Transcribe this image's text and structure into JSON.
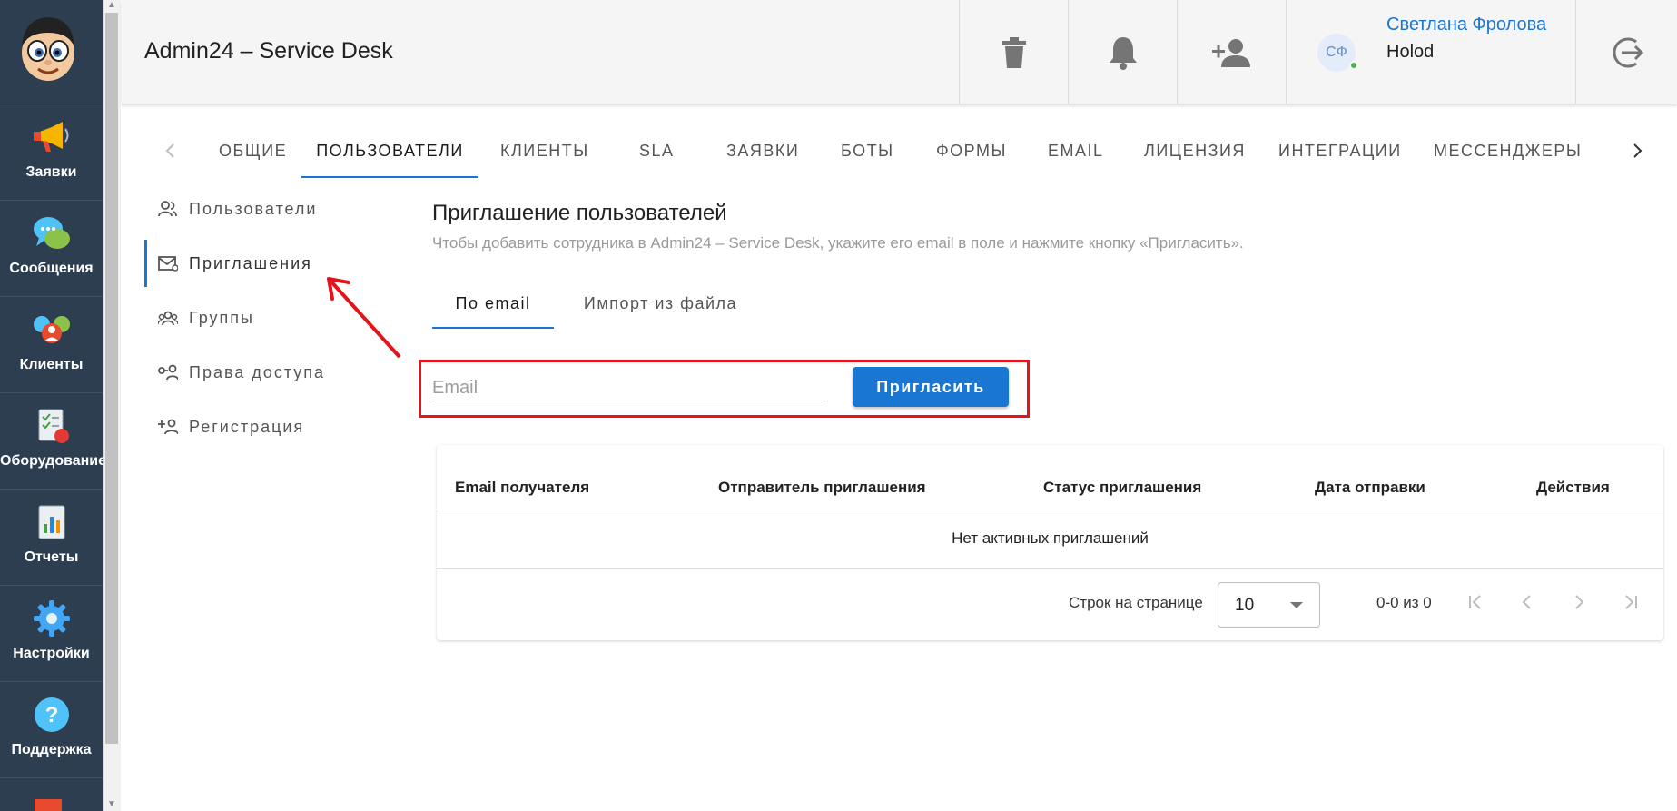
{
  "app": {
    "title": "Admin24 – Service Desk"
  },
  "sidebar": {
    "items": [
      {
        "label": "Заявки",
        "icon": "megaphone-icon"
      },
      {
        "label": "Сообщения",
        "icon": "chat-bubbles-icon"
      },
      {
        "label": "Клиенты",
        "icon": "clients-icon"
      },
      {
        "label": "Оборудование",
        "icon": "equipment-icon"
      },
      {
        "label": "Отчеты",
        "icon": "report-icon"
      },
      {
        "label": "Настройки",
        "icon": "gear-icon"
      },
      {
        "label": "Поддержка",
        "icon": "help-icon"
      }
    ]
  },
  "header": {
    "user": {
      "initials": "СФ",
      "name": "Светлана Фролова",
      "org": "Holod",
      "status_color": "#4caf50"
    }
  },
  "top_tabs": {
    "items": [
      "Общие",
      "Пользователи",
      "Клиенты",
      "SLA",
      "Заявки",
      "Боты",
      "Формы",
      "Email",
      "Лицензия",
      "Интеграции",
      "Мессенджеры"
    ],
    "active": "Пользователи"
  },
  "subnav": {
    "items": [
      {
        "label": "Пользователи",
        "icon": "users-icon"
      },
      {
        "label": "Приглашения",
        "icon": "mail-icon"
      },
      {
        "label": "Группы",
        "icon": "groups-icon"
      },
      {
        "label": "Права доступа",
        "icon": "access-rights-icon"
      },
      {
        "label": "Регистрация",
        "icon": "register-user-icon"
      }
    ],
    "active": "Приглашения"
  },
  "main": {
    "title": "Приглашение пользователей",
    "subtitle": "Чтобы добавить сотрудника в Admin24 – Service Desk, укажите его email в поле и нажмите кнопку «Пригласить».",
    "tabs": [
      "По email",
      "Импорт из файла"
    ],
    "active_tab": "По email",
    "email_placeholder": "Email",
    "email_value": "",
    "invite_label": "Пригласить"
  },
  "table": {
    "columns": [
      "Email получателя",
      "Отправитель приглашения",
      "Статус приглашения",
      "Дата отправки",
      "Действия"
    ],
    "rows": [],
    "empty_text": "Нет активных приглашений",
    "rows_per_page_label": "Строк на странице",
    "rows_per_page_value": "10",
    "page_info": "0-0 из 0"
  },
  "colors": {
    "accent": "#1976d2",
    "sidebar_bg": "#2c3e50",
    "annotation_red": "#e5141b"
  }
}
